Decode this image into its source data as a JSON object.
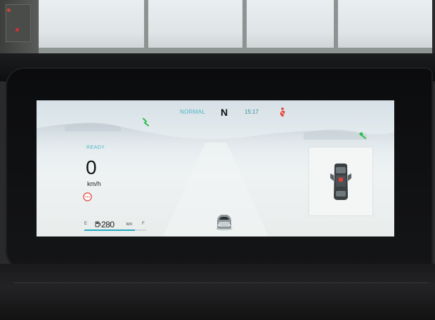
{
  "status_bar": {
    "drive_mode": "NORMAL",
    "gear": "N",
    "time": "15:17"
  },
  "left_cluster": {
    "ready_text": "READY",
    "speed": "0",
    "speed_unit": "km/h"
  },
  "range": {
    "empty_marker": "E",
    "full_marker": "F",
    "value": "280",
    "unit": "km",
    "level_fraction": 0.82
  },
  "icons": {
    "seatbelt": "seatbelt-warning-icon",
    "left_turn": "left-indicator-icon",
    "right_turn": "right-indicator-icon",
    "warning": "warning-circle-icon",
    "fuel": "fuel-pump-icon",
    "car_top": "vehicle-status-icon",
    "ego_car": "ego-vehicle-icon"
  },
  "colors": {
    "accent_teal": "#49b3c4",
    "indicator_green": "#2fbf55",
    "warning_red": "#e0413a",
    "range_bar": "#27a9bf"
  }
}
